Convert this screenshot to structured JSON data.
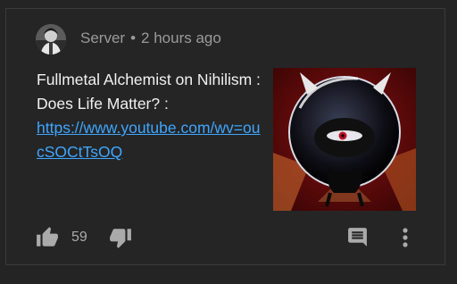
{
  "post": {
    "author": "Server",
    "separator": "•",
    "timestamp": "2 hours ago",
    "text": "Fullmetal Alchemist on Nihilism : Does Life Matter? :",
    "link": "https://www.youtube.com/watch?v=oucSOCtTsOQ",
    "link_display": "https://www.youtube.com/wv=oucSOCtTsOQ",
    "likes": "59"
  },
  "icons": {
    "like": "thumb-up-icon",
    "dislike": "thumb-down-icon",
    "comment": "comment-icon",
    "more": "more-vertical-icon"
  },
  "colors": {
    "background": "#242424",
    "text": "#f1f1f1",
    "meta": "#9a9a9a",
    "link": "#3ea6ff"
  }
}
